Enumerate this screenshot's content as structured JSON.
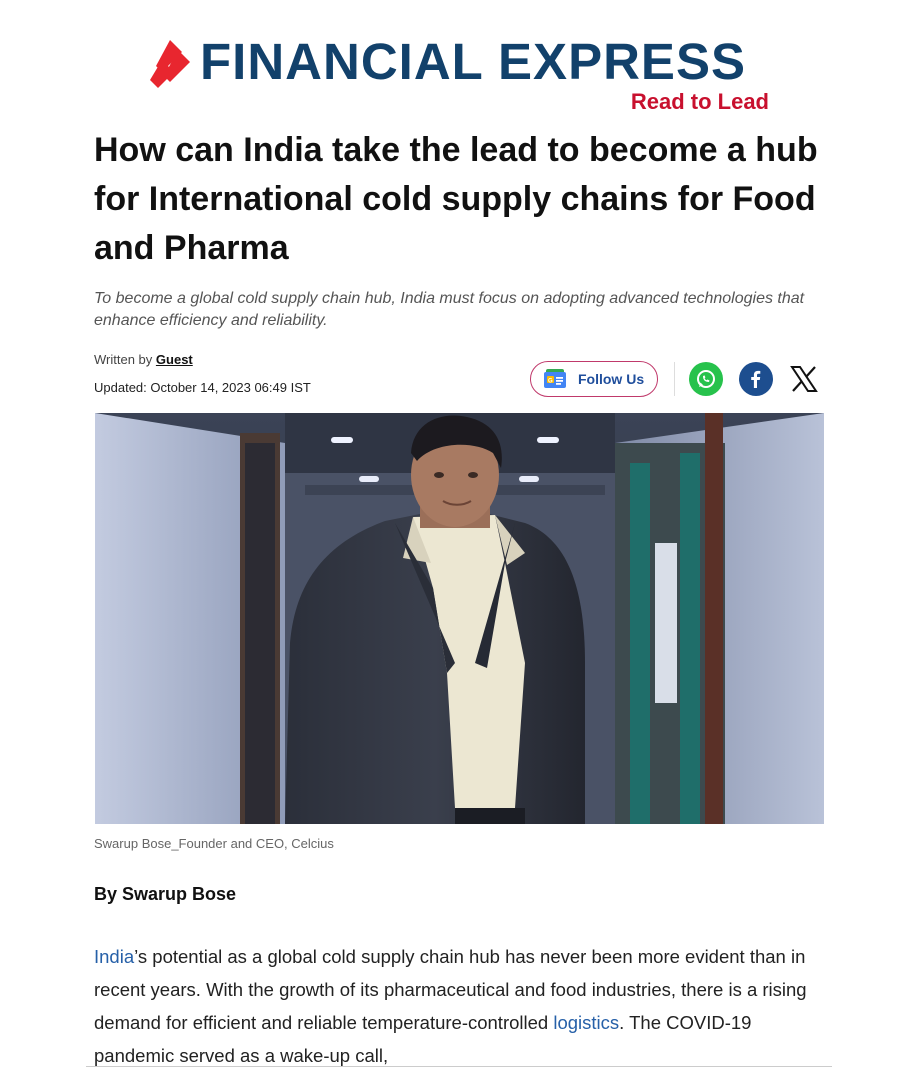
{
  "site": {
    "name": "FINANCIAL EXPRESS",
    "tagline": "Read to Lead",
    "brand_color": "#12416b",
    "accent_color": "#c8102e"
  },
  "article": {
    "title": "How can India take the lead to become a hub for International cold supply chains for Food and Pharma",
    "synopsis": "To become a global cold supply chain hub, India must focus on adopting advanced technologies that enhance efficiency and reliability.",
    "written_by_label": "Written by",
    "author_link": "Guest",
    "updated": "Updated: October 14, 2023 06:49 IST",
    "image_caption": "Swarup Bose_Founder and CEO, Celcius",
    "byline": "By Swarup Bose",
    "body": {
      "link_india": "India",
      "p1_part1": "’s potential as a global cold supply chain hub has never been more evident than in recent years. With the growth of its pharmaceutical and food industries, there is a rising demand for efficient and reliable temperature-controlled ",
      "link_logistics": "logistics",
      "p1_part2": ". The COVID-19 pandemic served as a wake-up call,"
    }
  },
  "social": {
    "follow_label": "Follow Us",
    "icons": [
      "google-news-icon",
      "whatsapp-icon",
      "facebook-icon",
      "x-icon"
    ]
  }
}
